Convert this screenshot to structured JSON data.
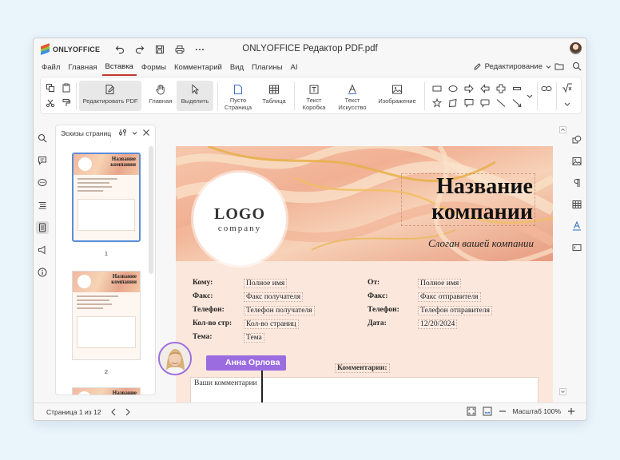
{
  "app": {
    "brand": "ONLYOFFICE",
    "title": "ONLYOFFICE Редактор PDF.pdf"
  },
  "menu": {
    "tabs": [
      "Файл",
      "Главная",
      "Вставка",
      "Формы",
      "Комментарий",
      "Вид",
      "Плагины",
      "AI"
    ],
    "active": "Вставка",
    "mode_label": "Редактирование"
  },
  "ribbon": {
    "edit_pdf": "Редактировать PDF",
    "home": "Главная",
    "select": "Выделить",
    "blank_page": [
      "Пусто",
      "Страница"
    ],
    "table": "Таблица",
    "text_box": [
      "Текст",
      "Коробка"
    ],
    "text_art": [
      "Текст",
      "Искусство"
    ],
    "image": "Изображение"
  },
  "thumbs": {
    "title": "Эскизы страниц",
    "pages": [
      "1",
      "2"
    ],
    "company_name": [
      "Название",
      "компании"
    ]
  },
  "document": {
    "logo_main": "LOGO",
    "logo_sub": "company",
    "company_name_1": "Название",
    "company_name_2": "компании",
    "slogan": "Слоган вашей компании",
    "left_fields": [
      {
        "label": "Кому:",
        "value": "Полное имя"
      },
      {
        "label": "Факс:",
        "value": "Факс получателя"
      },
      {
        "label": "Телефон:",
        "value": "Телефон получателя"
      },
      {
        "label": "Кол-во стр:",
        "value": "Кол-во страниц"
      },
      {
        "label": "Тема:",
        "value": "Тема"
      }
    ],
    "right_fields": [
      {
        "label": "От:",
        "value": "Полное имя"
      },
      {
        "label": "Факс:",
        "value": "Факс отправителя"
      },
      {
        "label": "Телефон:",
        "value": "Телефон отправителя"
      },
      {
        "label": "Дата:",
        "value": "12/20/2024"
      }
    ],
    "comments_label": "Комментарии:",
    "comments_value": "Ваши комментарии",
    "collaborator": "Анна Орлова"
  },
  "status": {
    "page": "Страница 1 из 12",
    "zoom": "Масштаб 100%"
  },
  "colors": {
    "accent_red": "#c0392b",
    "collab": "#9b6ce0",
    "select_blue": "#5b8dd9"
  }
}
